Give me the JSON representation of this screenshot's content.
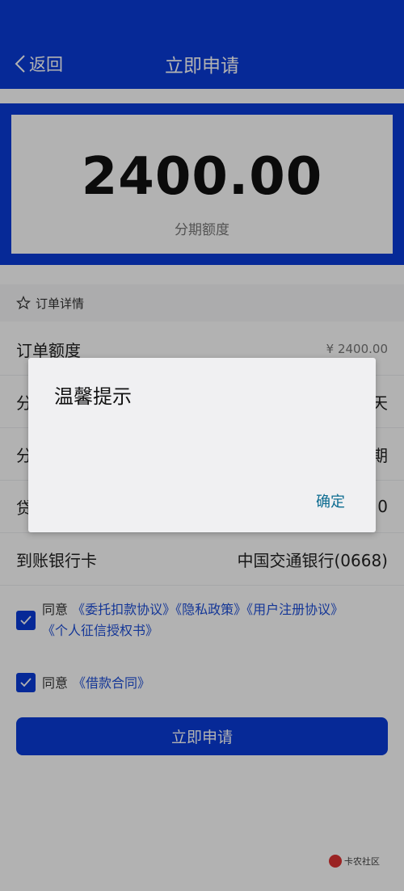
{
  "header": {
    "back_label": "返回",
    "title": "立即申请"
  },
  "amount": {
    "value": "2400.00",
    "label": "分期额度"
  },
  "order": {
    "section_title": "订单详情",
    "rows": [
      {
        "label": "订单额度",
        "value": "¥ 2400.00"
      },
      {
        "label": "分",
        "value": "天"
      },
      {
        "label": "分",
        "value": "期"
      },
      {
        "label": "贷",
        "value": "0"
      },
      {
        "label": "到账银行卡",
        "value": "中国交通银行(0668)"
      }
    ]
  },
  "agreements": [
    {
      "prefix": "同意",
      "links": "《委托扣款协议》《隐私政策》《用户注册协议》",
      "links2": "《个人征信授权书》",
      "checked": true
    },
    {
      "prefix": "同意",
      "links": "《借款合同》",
      "checked": true
    }
  ],
  "submit_label": "立即申请",
  "watermark": "卡农社区",
  "dialog": {
    "title": "温馨提示",
    "ok_label": "确定"
  },
  "colors": {
    "primary": "#0a3bd8",
    "link": "#1f4fd8",
    "dialog_button": "#0b6b90"
  }
}
